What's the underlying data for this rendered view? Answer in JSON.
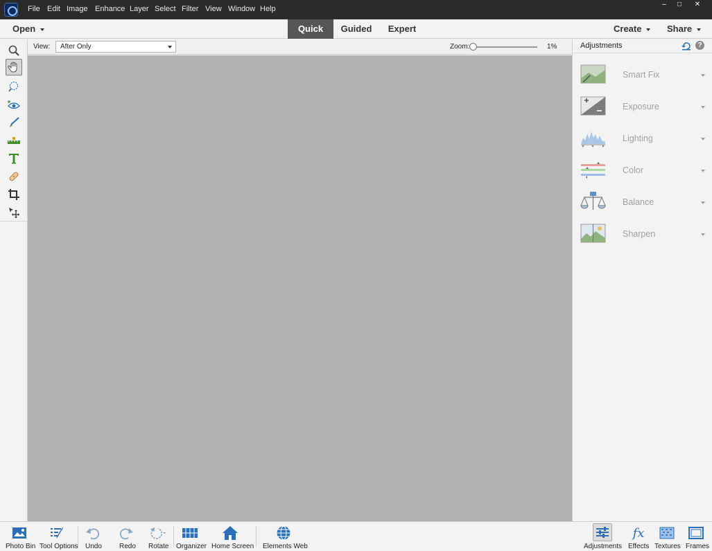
{
  "menu": {
    "items": [
      "File",
      "Edit",
      "Image",
      "Enhance",
      "Layer",
      "Select",
      "Filter",
      "View",
      "Window",
      "Help"
    ]
  },
  "window_controls": {
    "minimize": "–",
    "maximize": "□",
    "close": "✕"
  },
  "modebar": {
    "open_label": "Open",
    "tabs": [
      {
        "label": "Quick",
        "active": true
      },
      {
        "label": "Guided",
        "active": false
      },
      {
        "label": "Expert",
        "active": false
      }
    ],
    "create_label": "Create",
    "share_label": "Share"
  },
  "options": {
    "view_label": "View:",
    "view_value": "After Only",
    "zoom_label": "Zoom:",
    "zoom_value": "1%"
  },
  "tools": [
    {
      "name": "zoom-tool",
      "icon": "magnifier-icon"
    },
    {
      "name": "hand-tool",
      "icon": "hand-icon",
      "selected": true
    },
    {
      "name": "quick-selection-tool",
      "icon": "quick-selection-icon"
    },
    {
      "name": "red-eye-tool",
      "icon": "eye-icon"
    },
    {
      "name": "whiten-teeth-tool",
      "icon": "brush-icon"
    },
    {
      "name": "straighten-tool",
      "icon": "straighten-icon"
    },
    {
      "name": "type-tool",
      "icon": "type-icon"
    },
    {
      "name": "spot-healing-tool",
      "icon": "bandage-icon"
    },
    {
      "name": "crop-tool",
      "icon": "crop-icon"
    },
    {
      "name": "move-tool",
      "icon": "move-icon"
    }
  ],
  "panel": {
    "title": "Adjustments",
    "help": "?",
    "items": [
      {
        "label": "Smart Fix",
        "icon": "smart-fix-icon"
      },
      {
        "label": "Exposure",
        "icon": "exposure-icon"
      },
      {
        "label": "Lighting",
        "icon": "lighting-icon"
      },
      {
        "label": "Color",
        "icon": "color-icon"
      },
      {
        "label": "Balance",
        "icon": "balance-icon"
      },
      {
        "label": "Sharpen",
        "icon": "sharpen-icon"
      }
    ]
  },
  "bottombar": {
    "left": [
      {
        "label": "Photo Bin",
        "icon": "photo-bin-icon"
      },
      {
        "label": "Tool Options",
        "icon": "tool-options-icon"
      },
      {
        "label": "Undo",
        "icon": "undo-icon"
      },
      {
        "label": "Redo",
        "icon": "redo-icon"
      },
      {
        "label": "Rotate",
        "icon": "rotate-icon"
      },
      {
        "label": "Organizer",
        "icon": "organizer-icon"
      },
      {
        "label": "Home Screen",
        "icon": "home-icon"
      },
      {
        "label": "Elements Web",
        "icon": "globe-icon"
      }
    ],
    "right": [
      {
        "label": "Adjustments",
        "icon": "adjustments-icon",
        "selected": true
      },
      {
        "label": "Effects",
        "icon": "fx-icon"
      },
      {
        "label": "Textures",
        "icon": "textures-icon"
      },
      {
        "label": "Frames",
        "icon": "frames-icon"
      }
    ]
  },
  "colors": {
    "titlebar": "#2b2b2b",
    "canvas": "#b2b2b2",
    "active_tab": "#565656",
    "tool_green": "#3f8f2a",
    "tool_blue": "#2a6fb8",
    "panel_text": "#a0a0a0"
  }
}
